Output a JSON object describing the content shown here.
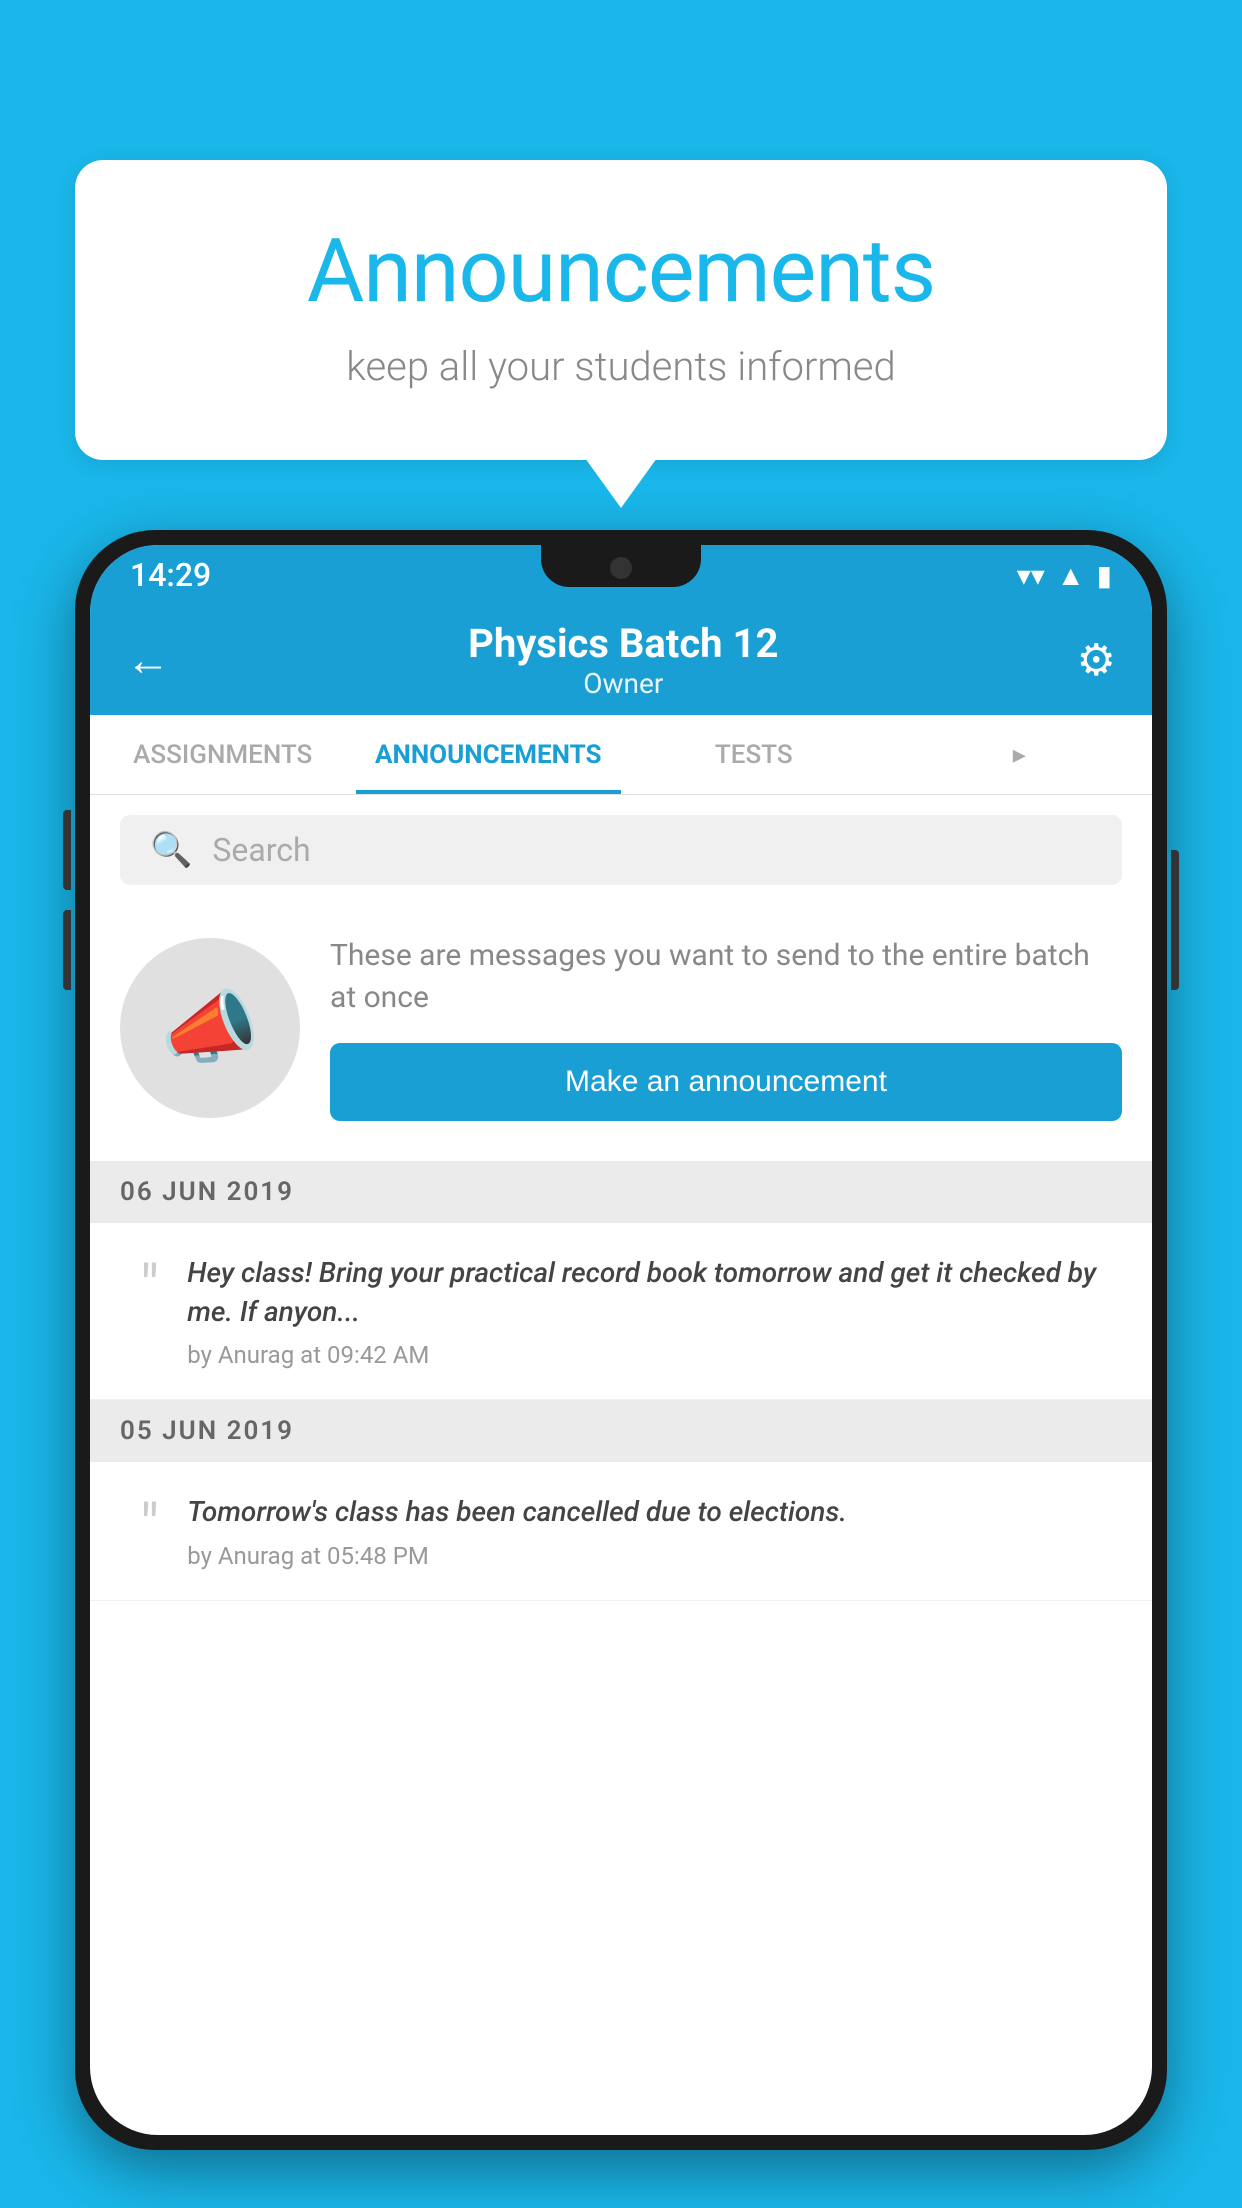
{
  "background_color": "#1ab7ea",
  "speech_bubble": {
    "title": "Announcements",
    "subtitle": "keep all your students informed"
  },
  "phone": {
    "status_bar": {
      "time": "14:29",
      "wifi": "▾",
      "signal": "▲",
      "battery": "▮"
    },
    "header": {
      "title": "Physics Batch 12",
      "subtitle": "Owner",
      "back_label": "←",
      "settings_label": "⚙"
    },
    "tabs": [
      {
        "label": "ASSIGNMENTS",
        "active": false
      },
      {
        "label": "ANNOUNCEMENTS",
        "active": true
      },
      {
        "label": "TESTS",
        "active": false
      },
      {
        "label": "▸",
        "active": false
      }
    ],
    "search": {
      "placeholder": "Search"
    },
    "promo": {
      "description": "These are messages you want to send to the entire batch at once",
      "button_label": "Make an announcement"
    },
    "announcements": [
      {
        "date": "06  JUN  2019",
        "text": "Hey class! Bring your practical record book tomorrow and get it checked by me. If anyon...",
        "meta": "by Anurag at 09:42 AM"
      },
      {
        "date": "05  JUN  2019",
        "text": "Tomorrow's class has been cancelled due to elections.",
        "meta": "by Anurag at 05:48 PM"
      }
    ]
  }
}
